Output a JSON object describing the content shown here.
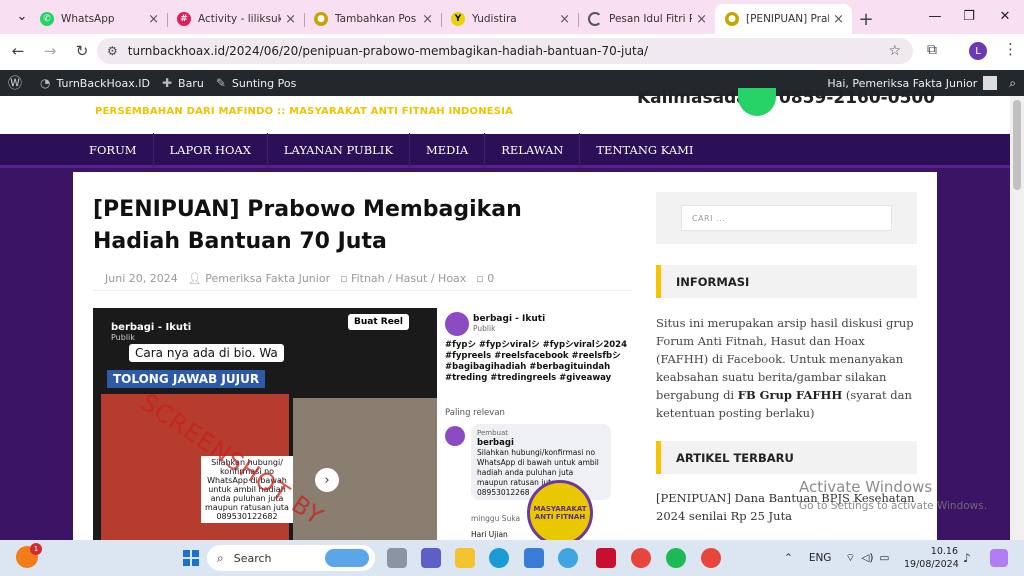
{
  "browser": {
    "tabs": [
      {
        "title": "WhatsApp",
        "icon": "whatsapp-icon",
        "color": "#25d366"
      },
      {
        "title": "Activity - liliksukm",
        "icon": "slack-icon",
        "color": "#e01e5a"
      },
      {
        "title": "Tambahkan Pos Ba",
        "icon": "site-icon",
        "color": "#c9a400"
      },
      {
        "title": "Yudistira",
        "icon": "yudistira-icon",
        "color": "#e8d400"
      },
      {
        "title": "Pesan Idul Fitri Pra",
        "icon": "loading-icon",
        "color": "#555555"
      },
      {
        "title": "[PENIPUAN] Prabo",
        "icon": "site-icon",
        "color": "#c9a400",
        "active": true
      }
    ],
    "url": "turnbackhoax.id/2024/06/20/penipuan-prabowo-membagikan-hadiah-bantuan-70-juta/",
    "profile_initial": "L"
  },
  "adminbar": {
    "site": "TurnBackHoax.ID",
    "new": "Baru",
    "edit": "Sunting Pos",
    "greeting": "Hai, Pemeriksa Fakta Junior"
  },
  "header": {
    "tagline": "PERSEMBAHAN DARI MAFINDO :: MASYARAKAT ANTI FITNAH INDONESIA",
    "kalimasada": "Kalimasada",
    "phone": "0859-2160-0500"
  },
  "nav": [
    "FORUM",
    "LAPOR HOAX",
    "LAYANAN PUBLIK",
    "MEDIA",
    "RELAWAN",
    "TENTANG KAMI"
  ],
  "article": {
    "title": "[PENIPUAN] Prabowo Membagikan Hadiah Bantuan 70 Juta",
    "date": "Juni 20, 2024",
    "author": "Pemeriksa Fakta Junior",
    "category": "Fitnah / Hasut / Hoax",
    "comments": "0"
  },
  "image": {
    "account": "berbagi - Ikuti",
    "scope": "Publik",
    "reel_button": "Buat Reel",
    "caption1": "Cara nya ada di bio. Wa",
    "caption2": "TOLONG JAWAB JUJUR",
    "bubble": "Silahkan hubungi/ konfirmasi no WhatsApp di bawah untuk ambil hadiah anda puluhan juta maupun ratusan juta 089530122682",
    "watermark": "SCREENSHOT BY",
    "fb_account": "berbagi - Ikuti",
    "fb_scope": "Publik",
    "fb_tags": "#fypシ #fypシviralシ #fypシviralシ2024 #fypreels #reelsfacebook #reelsfbシ #bagibagihadiah #berbagituindah #treding #tredingreels #giveaway",
    "relevan": "Paling relevan",
    "comment_author": "berbagi",
    "comment_role": "Pembuat",
    "comment_text": "Silahkan hubungi/konfirmasi no WhatsApp di bawah untuk ambil hadiah anda puluhan juta maupun ratusan juta 08953012268",
    "comment_meta": "minggu   Suka",
    "comment_next": "Hari Ujian",
    "seal_text": "MASYARAKAT ANTI FITNAH"
  },
  "sidebar": {
    "search_placeholder": "CARI ...",
    "info_title": "INFORMASI",
    "info_text_1": "Situs ini merupakan arsip hasil diskusi grup Forum Anti Fitnah, Hasut dan Hoax (FAFHH) di Facebook. Untuk menanyakan keabsahan suatu berita/gambar silakan bergabung di ",
    "info_link": "FB Grup FAFHH",
    "info_text_2": " (syarat dan ketentuan posting berlaku)",
    "recent_title": "ARTIKEL TERBARU",
    "recent_1": "[PENIPUAN] Dana Bantuan BPJS Kesehatan 2024 senilai Rp 25 Juta"
  },
  "activate": {
    "title": "Activate Windows",
    "sub": "Go to Settings to activate Windows."
  },
  "taskbar": {
    "weather_badge": "1",
    "search": "Search",
    "lang": "ENG",
    "time": "10.16",
    "date": "19/08/2024"
  }
}
